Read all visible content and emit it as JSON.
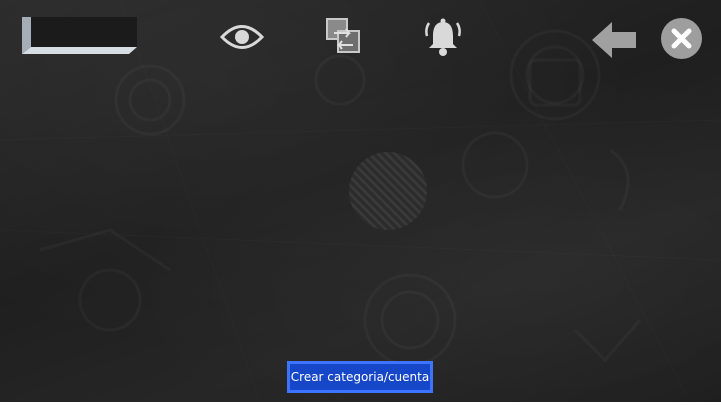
{
  "toolbar": {
    "title_plate_icon": "blank-title-plate",
    "visibility_icon": "eye-icon",
    "swap_icon": "swap-pages-icon",
    "notifications_icon": "bell-icon",
    "back_icon": "arrow-left-icon",
    "close_icon": "close-icon"
  },
  "main": {
    "placeholder_icon": "striped-disc-icon"
  },
  "actions": {
    "create_label": "Crear categoria/cuenta"
  },
  "colors": {
    "background": "#232323",
    "icon": "#d9d9d9",
    "button_fill": "#1747c9",
    "button_border": "#3e73ff"
  }
}
